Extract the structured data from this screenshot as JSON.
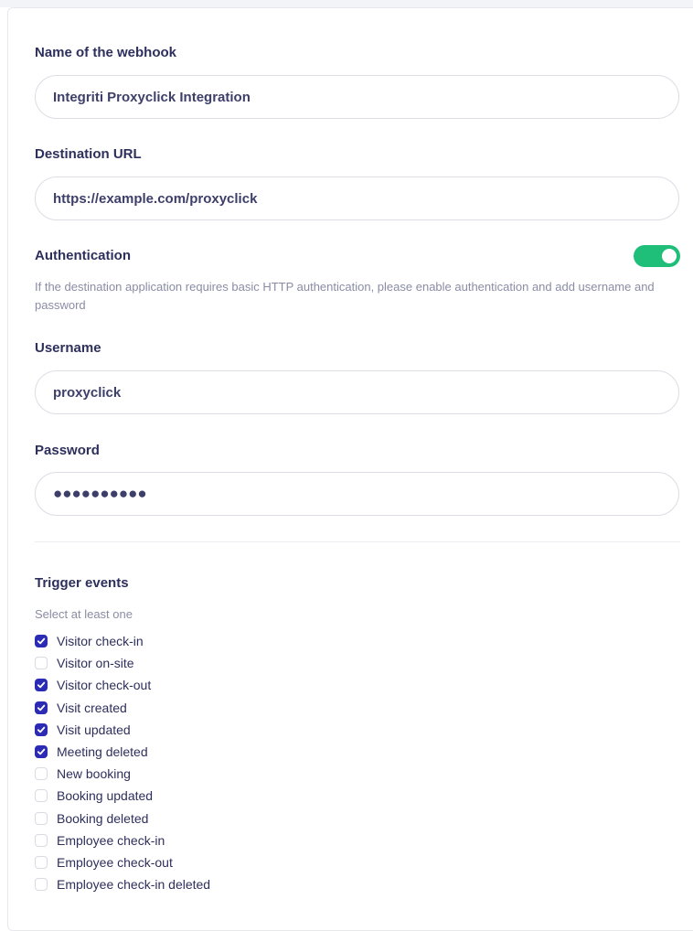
{
  "form": {
    "webhook_name": {
      "label": "Name of the webhook",
      "value": "Integriti Proxyclick Integration"
    },
    "destination_url": {
      "label": "Destination URL",
      "value": "https://example.com/proxyclick"
    },
    "authentication": {
      "label": "Authentication",
      "enabled": true,
      "help": "If the destination application requires basic HTTP authentication, please enable authentication and add username and password"
    },
    "username": {
      "label": "Username",
      "value": "proxyclick"
    },
    "password": {
      "label": "Password",
      "masked_value": "●●●●●●●●●●"
    }
  },
  "trigger_events": {
    "title": "Trigger events",
    "hint": "Select at least one",
    "items": [
      {
        "label": "Visitor check-in",
        "checked": true
      },
      {
        "label": "Visitor on-site",
        "checked": false
      },
      {
        "label": "Visitor check-out",
        "checked": true
      },
      {
        "label": "Visit created",
        "checked": true
      },
      {
        "label": "Visit updated",
        "checked": true
      },
      {
        "label": "Meeting deleted",
        "checked": true
      },
      {
        "label": "New booking",
        "checked": false
      },
      {
        "label": "Booking updated",
        "checked": false
      },
      {
        "label": "Booking deleted",
        "checked": false
      },
      {
        "label": "Employee check-in",
        "checked": false
      },
      {
        "label": "Employee check-out",
        "checked": false
      },
      {
        "label": "Employee check-in deleted",
        "checked": false
      }
    ]
  },
  "colors": {
    "toggle_on": "#1fbf7a",
    "checkbox_checked": "#2b2bb5",
    "text_primary": "#2d2f5c",
    "text_muted": "#8a8ca5"
  }
}
